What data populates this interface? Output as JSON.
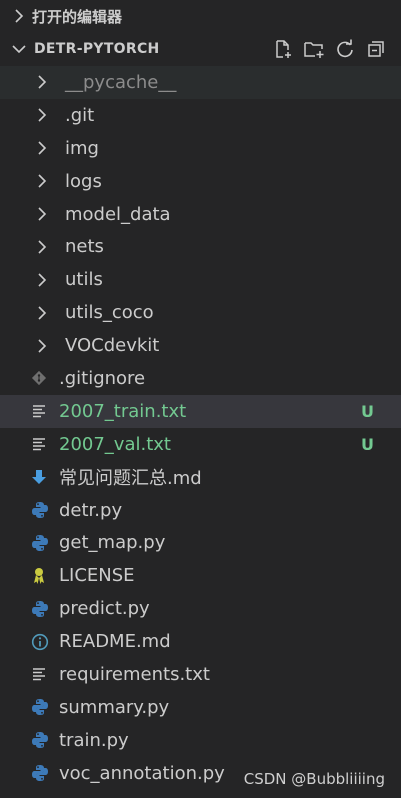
{
  "open_editors": {
    "title": "打开的编辑器"
  },
  "explorer": {
    "title": "DETR-PYTORCH",
    "actions": [
      "new-file-icon",
      "new-folder-icon",
      "refresh-icon",
      "collapse-all-icon"
    ]
  },
  "tree": [
    {
      "label": "__pycache__",
      "kind": "folder",
      "dim": true
    },
    {
      "label": ".git",
      "kind": "folder"
    },
    {
      "label": "img",
      "kind": "folder"
    },
    {
      "label": "logs",
      "kind": "folder"
    },
    {
      "label": "model_data",
      "kind": "folder"
    },
    {
      "label": "nets",
      "kind": "folder"
    },
    {
      "label": "utils",
      "kind": "folder"
    },
    {
      "label": "utils_coco",
      "kind": "folder"
    },
    {
      "label": "VOCdevkit",
      "kind": "folder"
    },
    {
      "label": ".gitignore",
      "kind": "git-file"
    },
    {
      "label": "2007_train.txt",
      "kind": "text-file",
      "status": "U",
      "selected": true
    },
    {
      "label": "2007_val.txt",
      "kind": "text-file",
      "status": "U"
    },
    {
      "label": "常见问题汇总.md",
      "kind": "markdown-file"
    },
    {
      "label": "detr.py",
      "kind": "python-file"
    },
    {
      "label": "get_map.py",
      "kind": "python-file"
    },
    {
      "label": "LICENSE",
      "kind": "license-file"
    },
    {
      "label": "predict.py",
      "kind": "python-file"
    },
    {
      "label": "README.md",
      "kind": "info-file"
    },
    {
      "label": "requirements.txt",
      "kind": "text-file"
    },
    {
      "label": "summary.py",
      "kind": "python-file"
    },
    {
      "label": "train.py",
      "kind": "python-file"
    },
    {
      "label": "voc_annotation.py",
      "kind": "python-file"
    }
  ],
  "watermark": "CSDN @Bubbliiiing",
  "colors": {
    "untracked": "#73c991",
    "python": "#3d7ab8",
    "markdown": "#4a9ee0",
    "license": "#cbcb41",
    "info": "#519aba"
  }
}
